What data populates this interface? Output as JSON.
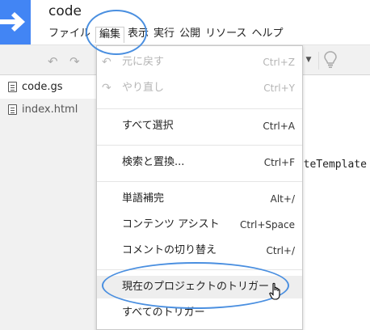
{
  "app": {
    "title": "code",
    "brand_color": "#4285f4"
  },
  "menubar": {
    "items": [
      {
        "label": "ファイル",
        "active": false
      },
      {
        "label": "編集",
        "active": true
      },
      {
        "label": "表示",
        "active": false
      },
      {
        "label": "実行",
        "active": false
      },
      {
        "label": "公開",
        "active": false
      },
      {
        "label": "リソース",
        "active": false
      },
      {
        "label": "ヘルプ",
        "active": false
      }
    ]
  },
  "toolbar": {
    "undo_icon": "undo-icon",
    "redo_icon": "redo-icon",
    "dropdown_icon": "chevron-down-icon",
    "bulb_icon": "lightbulb-icon"
  },
  "files": [
    {
      "name": "code.gs",
      "selected": true
    },
    {
      "name": "index.html",
      "selected": false
    }
  ],
  "editor": {
    "visible_code": "eateTemplate"
  },
  "edit_menu": {
    "undo": {
      "label": "元に戻す",
      "shortcut": "Ctrl+Z"
    },
    "redo": {
      "label": "やり直し",
      "shortcut": "Ctrl+Y"
    },
    "select_all": {
      "label": "すべて選択",
      "shortcut": "Ctrl+A"
    },
    "find_replace": {
      "label": "検索と置換...",
      "shortcut": "Ctrl+F"
    },
    "word_complete": {
      "label": "単語補完",
      "shortcut": "Alt+/"
    },
    "content_assist": {
      "label": "コンテンツ アシスト",
      "shortcut": "Ctrl+Space"
    },
    "toggle_comment": {
      "label": "コメントの切り替え",
      "shortcut": "Ctrl+/"
    },
    "current_triggers": {
      "label": "現在のプロジェクトのトリガー"
    },
    "all_triggers": {
      "label": "すべてのトリガー"
    }
  },
  "annotation_color": "#4a8fe0"
}
